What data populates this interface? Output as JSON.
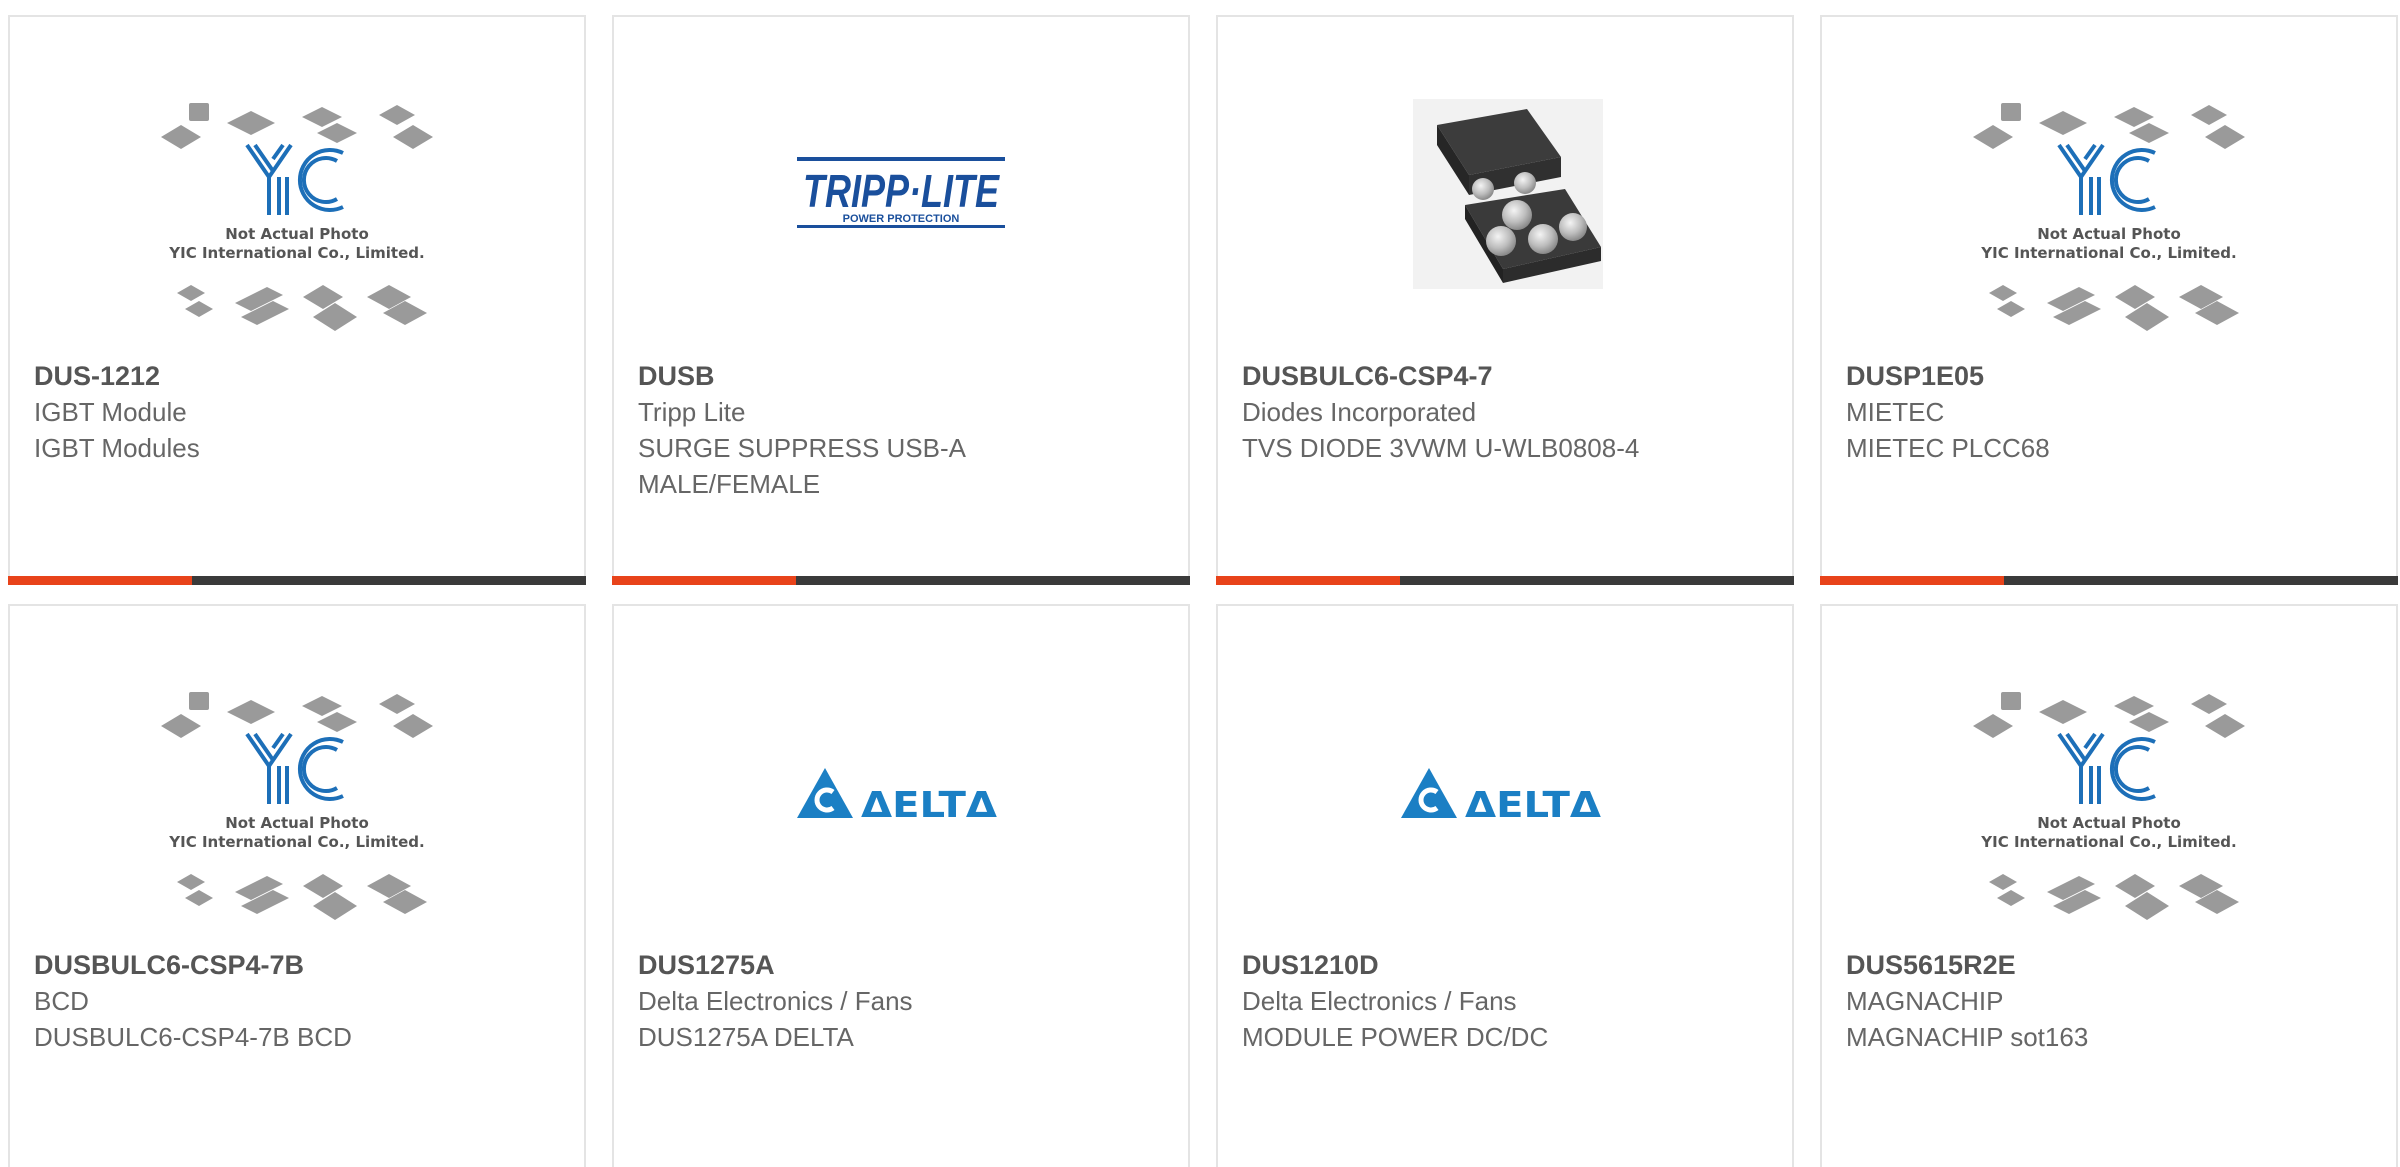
{
  "products": [
    {
      "part": "DUS-1212",
      "manufacturer": "IGBT Module",
      "description": "IGBT Modules",
      "image": "yic-placeholder"
    },
    {
      "part": "DUSB",
      "manufacturer": "Tripp Lite",
      "description": "SURGE SUPPRESS USB-A MALE/FEMALE",
      "image": "tripp-lite-logo",
      "logo_text": "TRIPP·LITE",
      "logo_sub": "POWER PROTECTION"
    },
    {
      "part": "DUSBULC6-CSP4-7",
      "manufacturer": "Diodes Incorporated",
      "description": "TVS DIODE 3VWM U-WLB0808-4",
      "image": "chip-photo"
    },
    {
      "part": "DUSP1E05",
      "manufacturer": "MIETEC",
      "description": "MIETEC PLCC68",
      "image": "yic-placeholder"
    },
    {
      "part": "DUSBULC6-CSP4-7B",
      "manufacturer": "BCD",
      "description": "DUSBULC6-CSP4-7B BCD",
      "image": "yic-placeholder"
    },
    {
      "part": "DUS1275A",
      "manufacturer": "Delta Electronics / Fans",
      "description": "DUS1275A DELTA",
      "image": "delta-logo",
      "logo_text": "ΔELTΔ"
    },
    {
      "part": "DUS1210D",
      "manufacturer": "Delta Electronics / Fans",
      "description": "MODULE POWER DC/DC",
      "image": "delta-logo",
      "logo_text": "ΔELTΔ"
    },
    {
      "part": "DUS5615R2E",
      "manufacturer": "MAGNACHIP",
      "description": "MAGNACHIP sot163",
      "image": "yic-placeholder"
    }
  ],
  "placeholder": {
    "logo_text": "YIC",
    "line1": "Not Actual Photo",
    "line2": "YIC International Co., Limited."
  },
  "colors": {
    "accent": "#e8431a",
    "bar": "#3a3a3a",
    "yic_blue": "#1d6fb8",
    "tripp_blue": "#1a4f9c",
    "delta_blue": "#1b7fc4"
  }
}
